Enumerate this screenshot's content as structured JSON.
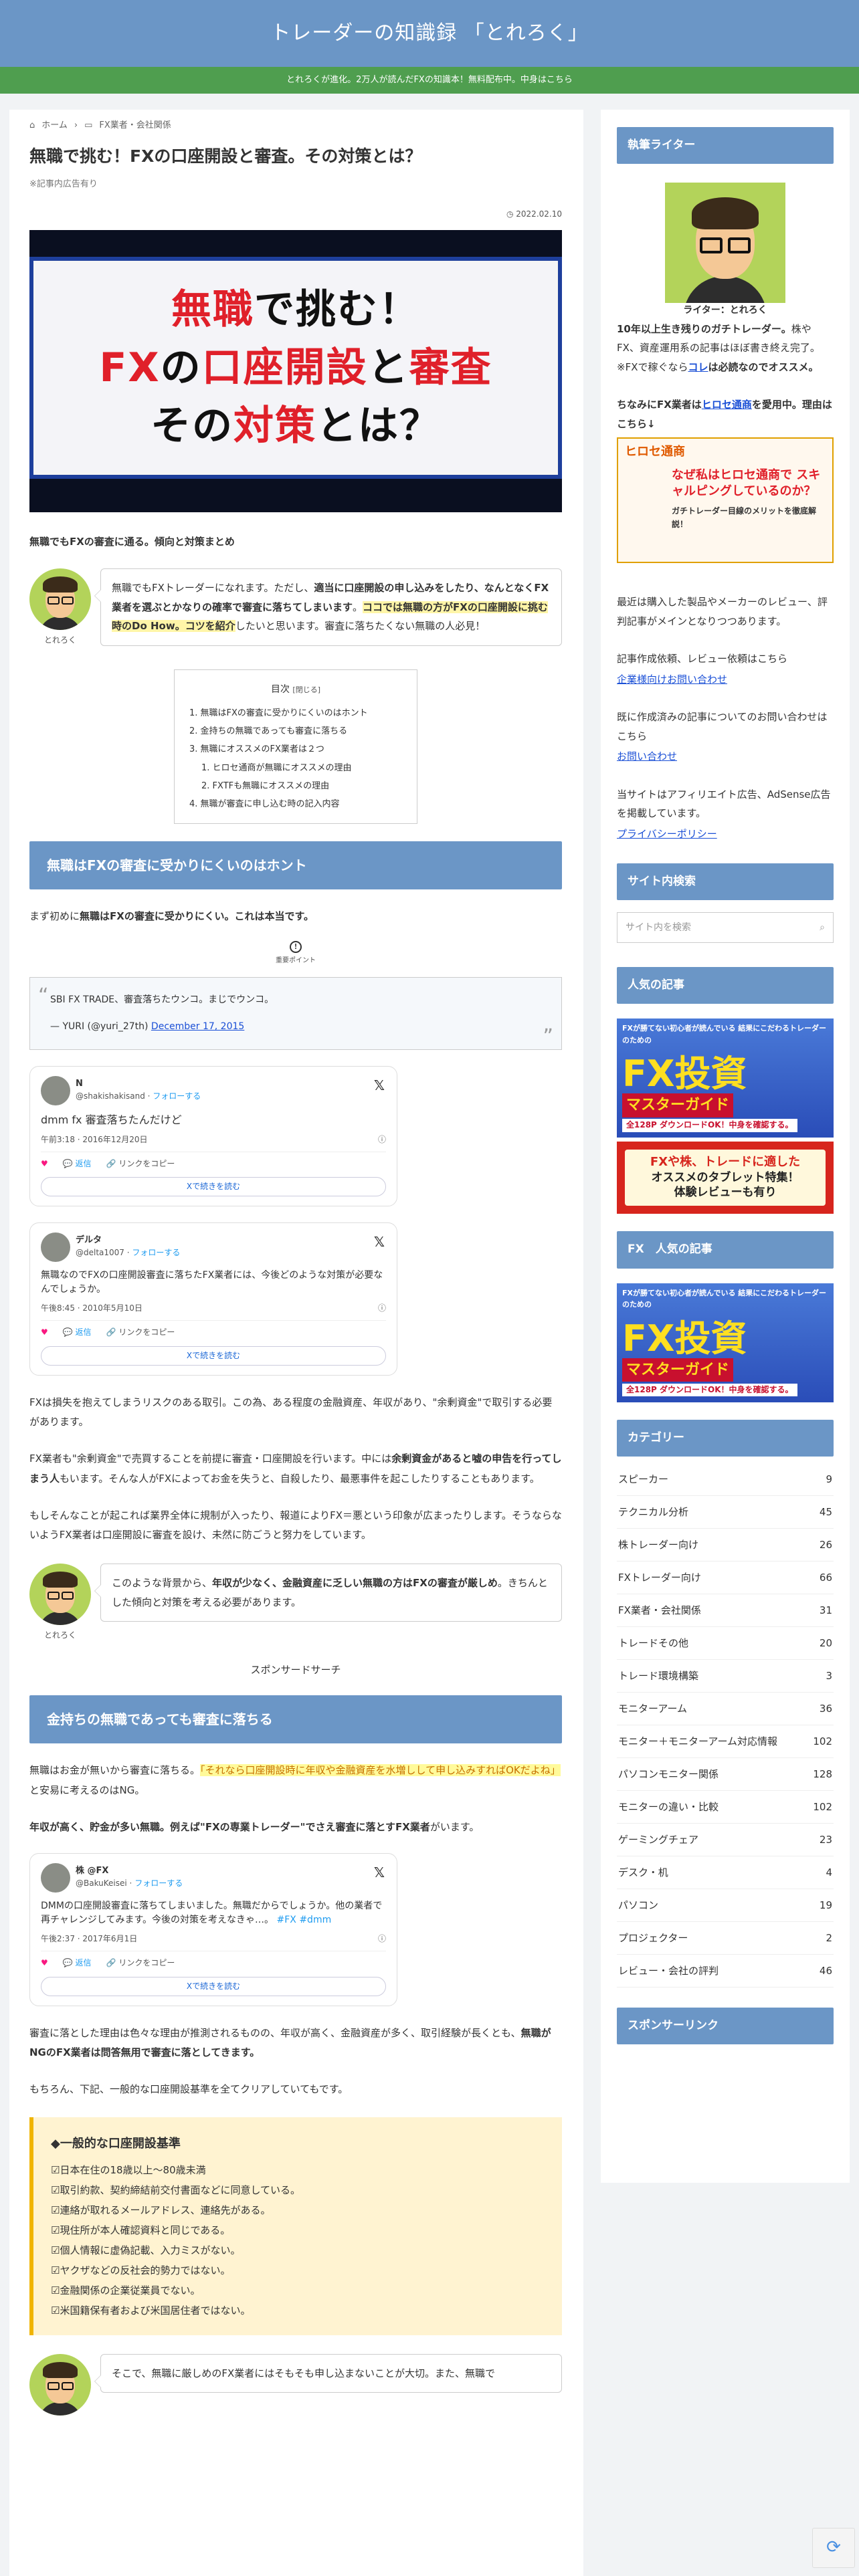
{
  "site": {
    "title": "トレーダーの知識録 「とれろく」",
    "notice": "とれろくが進化。2万人が読んだFXの知識本！無料配布中。中身はこちら"
  },
  "breadcrumb": {
    "home": "ホーム",
    "category": "FX業者・会社関係"
  },
  "article": {
    "title": "無職で挑む！FXの口座開設と審査。その対策とは？",
    "pr": "※記事内広告有り",
    "date": "2022.02.10",
    "eyecatch_lines": [
      "無職で挑む！",
      "FXの口座開設と審査",
      "その対策とは？"
    ],
    "lead": "無職でもFXの審査に通る。傾向と対策まとめ",
    "speech1_a": "無職でもFXトレーダーになれます。ただし、",
    "speech1_b": "適当に口座開設の申し込みをしたり、なんとなくFX業者を選ぶとかなりの確率で審査に落ちてしまいます",
    "speech1_c": "。",
    "speech1_d": "ココでは無職の方がFXの口座開設に挑む時のDo How。コツを紹介",
    "speech1_e": "したいと思います。審査に落ちたくない無職の人必見！",
    "author_name": "とれろく",
    "toc": {
      "title": "目次",
      "toggle": "[閉じる]",
      "items": [
        "1. 無職はFXの審査に受かりにくいのはホント",
        "2. 金持ちの無職であっても審査に落ちる",
        "3. 無職にオススメのFX業者は２つ",
        "1. ヒロセ通商が無職にオススメの理由",
        "2. FXTFも無職にオススメの理由",
        "4. 無職が審査に申し込む時の記入内容"
      ]
    },
    "h2_1": "無職はFXの審査に受かりにくいのはホント",
    "p1_a": "まず初めに",
    "p1_b": "無職はFXの審査に受かりにくい。これは本当です。",
    "mark_label": "重要ポイント",
    "quote": {
      "text": "SBI FX TRADE、審査落ちたウンコ。まじでウンコ。",
      "cite": "— YURI (@yuri_27th)",
      "cite_link": "December 17, 2015"
    },
    "tweets": [
      {
        "name": "N",
        "handle": "@shakishakisand",
        "follow": "フォローする",
        "text": "dmm fx 審査落ちたんだけど",
        "time": "午前3:18 · 2016年12月20日",
        "likes": "",
        "reply": "返信",
        "copy": "リンクをコピー",
        "btn": "Xで続きを読む"
      },
      {
        "name": "デルタ",
        "handle": "@delta1007",
        "follow": "フォローする",
        "text": "無職なのでFXの口座開設審査に落ちたFX業者には、今後どのような対策が必要なんでしょうか。",
        "time": "午後8:45 · 2010年5月10日",
        "likes": "",
        "reply": "返信",
        "copy": "リンクをコピー",
        "btn": "Xで続きを読む"
      },
      {
        "name": "株 @FX",
        "handle": "@BakuKeisei",
        "follow": "フォローする",
        "text": "DMMの口座開設審査に落ちてしまいました。無職だからでしょうか。他の業者で再チャレンジしてみます。今後の対策を考えなきゃ…。",
        "tags": "#FX #dmm",
        "time": "午後2:37 · 2017年6月1日",
        "likes": "",
        "reply": "返信",
        "copy": "リンクをコピー",
        "btn": "Xで続きを読む"
      }
    ],
    "p2": "FXは損失を抱えてしまうリスクのある取引。この為、ある程度の金融資産、年収があり、\"余剰資金\"で取引する必要があります。",
    "p3_a": "FX業者も\"余剰資金\"で売買することを前提に審査・口座開設を行います。中には",
    "p3_b": "余剰資金があると嘘の申告を行ってしまう人",
    "p3_c": "もいます。そんな人がFXによってお金を失うと、自殺したり、最悪事件を起こしたりすることもあります。",
    "p4": "もしそんなことが起これば業界全体に規制が入ったり、報道によりFX＝悪という印象が広まったりします。そうならないようFX業者は口座開設に審査を設け、未然に防ごうと努力をしています。",
    "speech2_a": "このような背景から、",
    "speech2_b": "年収が少なく、金融資産に乏しい無職の方はFXの審査が厳しめ",
    "speech2_c": "。きちんとした傾向と対策を考える必要があります。",
    "sponsor_search": "スポンサードサーチ",
    "h2_2": "金持ちの無職であっても審査に落ちる",
    "p5_a": "無職はお金が無いから審査に落ちる。",
    "p5_b": "「それなら口座開設時に年収や金融資産を水増しして申し込みすればOKだよね」",
    "p5_c": "と安易に考えるのはNG。",
    "p6_a": "年収が高く、貯金が多い無職。例えば\"FXの専業トレーダー\"でさえ審査に落とすFX業者",
    "p6_b": "がいます。",
    "p7_a": "審査に落とした理由は色々な理由が推測されるものの、年収が高く、金融資産が多く、取引経験が長くとも、",
    "p7_b": "無職がNGのFX業者は問答無用で審査に落としてきます。",
    "p8": "もちろん、下記、一般的な口座開設基準を全てクリアしていてもです。",
    "ybox": {
      "title": "◆一般的な口座開設基準",
      "items": [
        "☑日本在住の18歳以上〜80歳未満",
        "☑取引約款、契約締結前交付書面などに同意している。",
        "☑連絡が取れるメールアドレス、連絡先がある。",
        "☑現住所が本人確認資料と同じである。",
        "☑個人情報に虚偽記載、入力ミスがない。",
        "☑ヤクザなどの反社会的勢力ではない。",
        "☑金融関係の企業従業員でない。",
        "☑米国籍保有者および米国居住者ではない。"
      ]
    },
    "speech3": "そこで、無職に厳しめのFX業者にはそもそも申し込まないことが大切。また、無職で"
  },
  "sidebar": {
    "writer_heading": "執筆ライター",
    "writer_caption": "ライター：とれろく",
    "writer_text_a": "10年以上生き残りのガチトレーダー。",
    "writer_text_b": "株や FX、資産運用系の記事はほぼ書き終え完了。※FXで稼ぐなら",
    "writer_link": "コレ",
    "writer_text_c": "は必読なのでオススメ。",
    "hirose_a": "ちなみにFX業者は",
    "hirose_link": "ヒロセ通商",
    "hirose_b": "を愛用中。理由はこちら↓",
    "hirose_banner": {
      "logo": "ヒロセ通商",
      "line1": "なぜ私はヒロセ通商で スキャルピングしているのか？",
      "line2": "ガチトレーダー目線のメリットを徹底解説！"
    },
    "review_text": "最近は購入した製品やメーカーのレビュー、評判記事がメインとなりつつあります。",
    "contact_text": "記事作成依頼、レビュー依頼はこちら",
    "contact_link": "企業様向けお問い合わせ",
    "existing_text": "既に作成済みの記事についてのお問い合わせはこちら",
    "existing_link": "お問い合わせ",
    "affiliate_text": "当サイトはアフィリエイト広告、AdSense広告を掲載しています。",
    "privacy_link": "プライバシーポリシー",
    "search_heading": "サイト内検索",
    "search_placeholder": "サイト内を検索",
    "popular_heading": "人気の記事",
    "banner_fx": {
      "top": "FXが勝てない初心者が読んでいる 結果にこだわるトレーダーのための",
      "big": "FX投資",
      "sub": "マスターガイド",
      "bottom": "全128P ダウンロードOK！中身を確認する。"
    },
    "banner_tablet": {
      "line1": "FXや株、トレードに適した",
      "line2": "オススメのタブレット特集！",
      "line3": "体験レビューも有り"
    },
    "fx_popular_heading": "FX　人気の記事",
    "category_heading": "カテゴリー",
    "categories": [
      {
        "name": "スピーカー",
        "count": "9"
      },
      {
        "name": "テクニカル分析",
        "count": "45"
      },
      {
        "name": "株トレーダー向け",
        "count": "26"
      },
      {
        "name": "FXトレーダー向け",
        "count": "66"
      },
      {
        "name": "FX業者・会社関係",
        "count": "31"
      },
      {
        "name": "トレードその他",
        "count": "20"
      },
      {
        "name": "トレード環境構築",
        "count": "3"
      },
      {
        "name": "モニターアーム",
        "count": "36"
      },
      {
        "name": "モニター＋モニターアーム対応情報",
        "count": "102"
      },
      {
        "name": "パソコンモニター関係",
        "count": "128"
      },
      {
        "name": "モニターの違い・比較",
        "count": "102"
      },
      {
        "name": "ゲーミングチェア",
        "count": "23"
      },
      {
        "name": "デスク・机",
        "count": "4"
      },
      {
        "name": "パソコン",
        "count": "19"
      },
      {
        "name": "プロジェクター",
        "count": "2"
      },
      {
        "name": "レビュー・会社の評判",
        "count": "46"
      }
    ],
    "sponsor_heading": "スポンサーリンク"
  },
  "colors": {
    "header": "#6b96c6",
    "notice": "#4f9e4f",
    "accent_red": "#e0202a",
    "link": "#1a4fd6"
  }
}
